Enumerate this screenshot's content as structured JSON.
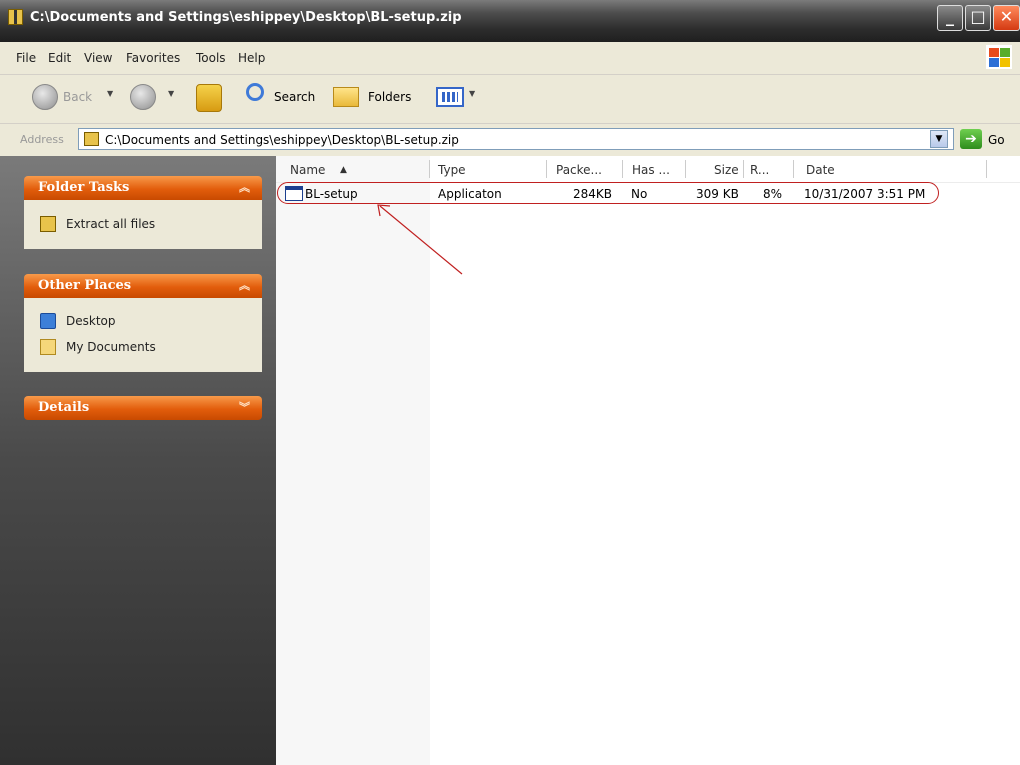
{
  "window": {
    "title": "C:\\Documents and Settings\\eshippey\\Desktop\\BL-setup.zip"
  },
  "menu": [
    "File",
    "Edit",
    "View",
    "Favorites",
    "Tools",
    "Help"
  ],
  "toolbar": {
    "back_label": "Back",
    "search_label": "Search",
    "folders_label": "Folders"
  },
  "address": {
    "label": "Address",
    "value": "C:\\Documents and Settings\\eshippey\\Desktop\\BL-setup.zip",
    "go_label": "Go"
  },
  "task_pane": {
    "folder_tasks": {
      "title": "Folder Tasks",
      "items": [
        "Extract all files"
      ]
    },
    "other_places": {
      "title": "Other Places",
      "items": [
        "Desktop",
        "My Documents"
      ]
    },
    "details": {
      "title": "Details"
    }
  },
  "file_list": {
    "columns": [
      "Name",
      "Type",
      "Packe...",
      "Has ...",
      "Size",
      "R...",
      "Date"
    ],
    "rows": [
      {
        "name": "BL-setup",
        "type": "Applicaton",
        "packed": "284KB",
        "has_password": "No",
        "size": "309 KB",
        "ratio": "8%",
        "date": "10/31/2007 3:51 PM"
      }
    ]
  },
  "colors": {
    "pane_header": "#e25d0c",
    "highlight": "#c02020",
    "title_bar": "#2c2c2c"
  }
}
